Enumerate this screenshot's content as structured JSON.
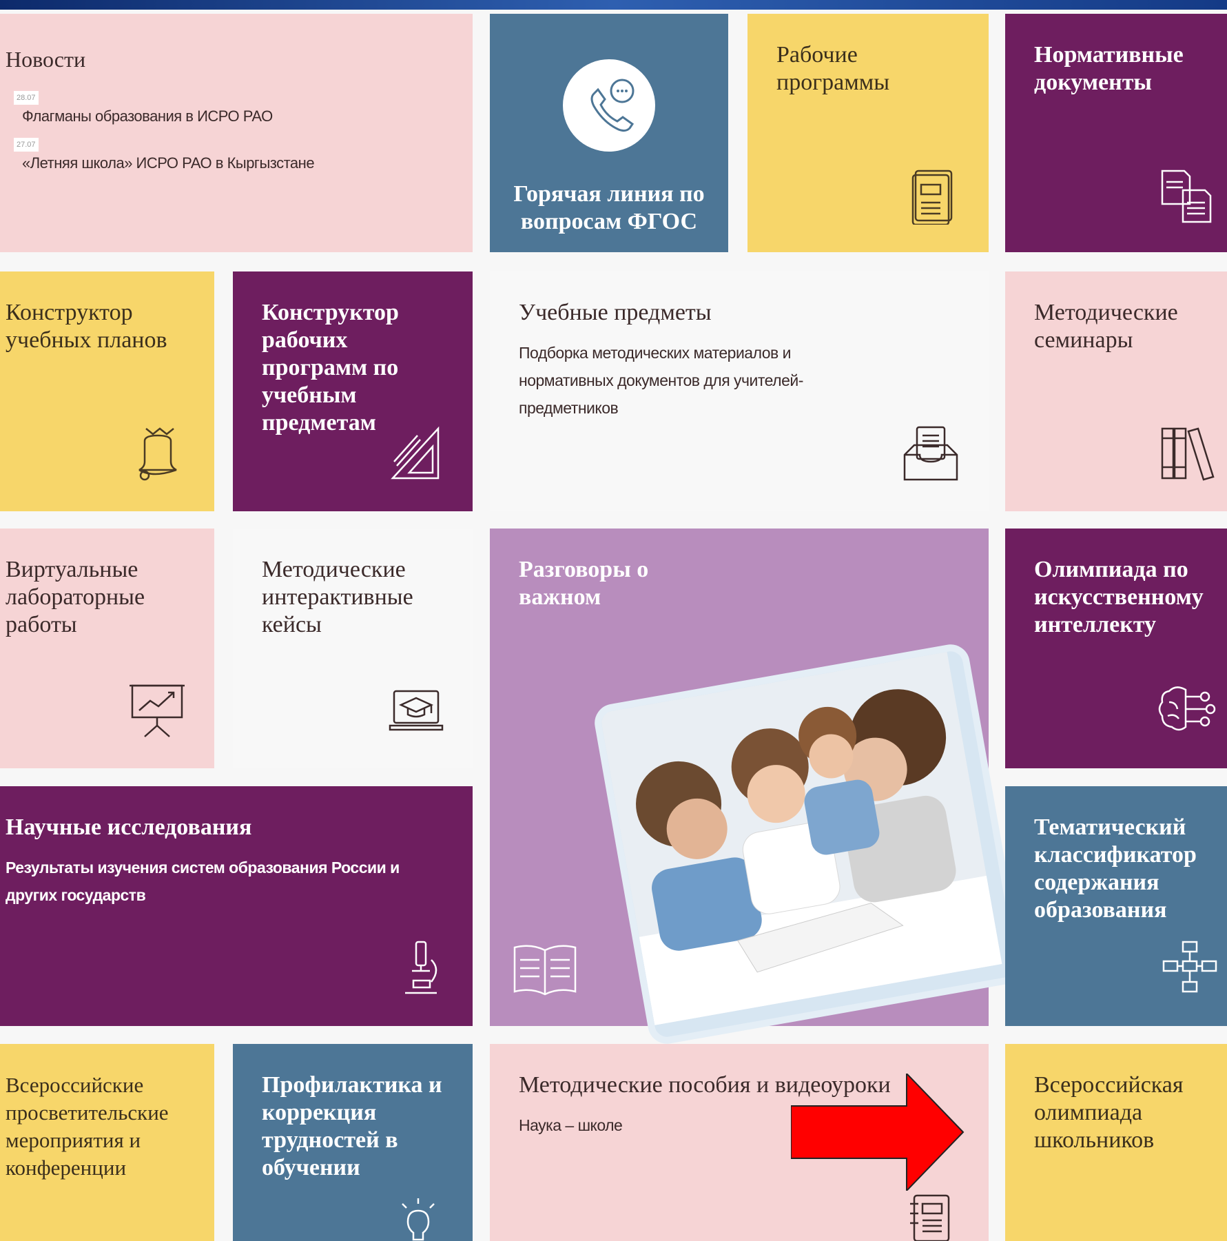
{
  "news": {
    "title": "Новости",
    "items": [
      {
        "date": "28.07",
        "text": "Флагманы образования в ИСРО РАО"
      },
      {
        "date": "27.07",
        "text": "«Летняя школа» ИСРО РАО в Кыргызстане"
      }
    ]
  },
  "hotline": {
    "title": "Горячая линия по вопросам ФГОС"
  },
  "work_programs": {
    "title": "Рабочие программы"
  },
  "normative_docs": {
    "title": "Нормативные документы"
  },
  "curriculum_builder": {
    "title": "Конструктор учебных планов"
  },
  "program_builder": {
    "title": "Конструктор рабочих программ по учебным предметам"
  },
  "subjects": {
    "title": "Учебные предметы",
    "description": "Подборка методических материалов и нормативных документов для учителей-предметников"
  },
  "seminars": {
    "title": "Методические семинары"
  },
  "virtual_labs": {
    "title": "Виртуальные лабораторные работы"
  },
  "interactive_cases": {
    "title": "Методические интерактивные кейсы"
  },
  "important_talks": {
    "title": "Разговоры о важном"
  },
  "ai_olympiad": {
    "title": "Олимпиада по искусственному интеллекту"
  },
  "research": {
    "title": "Научные исследования",
    "description": "Результаты изучения систем образования России и других государств"
  },
  "classifier": {
    "title": "Тематический классификатор содержания образования"
  },
  "events": {
    "title": "Всероссийские просветительские мероприятия и конференции"
  },
  "prevention": {
    "title": "Профилактика и коррекция трудностей в обучении"
  },
  "manuals": {
    "title": "Методические пособия и видеоуроки",
    "description": "Наука – школе"
  },
  "school_olympiad": {
    "title": "Всероссийская олимпиада школьников"
  },
  "colors": {
    "pink": "#f6d4d5",
    "yellow": "#f7d66a",
    "purple": "#6e1e5f",
    "steel": "#4d7696",
    "lilac": "#b88dbd",
    "arrow": "#ff0000"
  },
  "icons": [
    "phone-chat-icon",
    "document-icon",
    "documents-icon",
    "bell-icon",
    "ruler-triangle-icon",
    "inbox-tray-icon",
    "books-icon",
    "presentation-chart-icon",
    "laptop-graduation-icon",
    "open-book-icon",
    "ai-brain-icon",
    "microscope-icon",
    "hierarchy-icon",
    "lightbulb-icon",
    "notebook-icon",
    "red-arrow-icon"
  ]
}
